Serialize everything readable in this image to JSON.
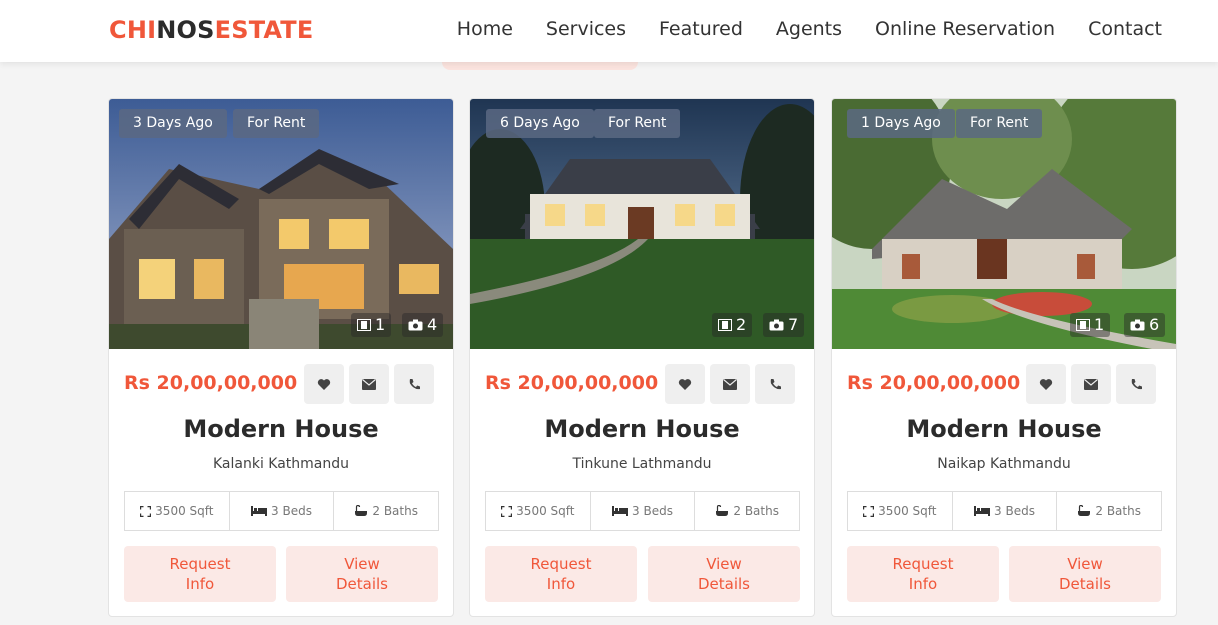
{
  "brand": {
    "part1": "CHI",
    "part2": "NOS",
    "part3": "ESTATE"
  },
  "nav": [
    "Home",
    "Services",
    "Featured",
    "Agents",
    "Online Reservation",
    "Contact"
  ],
  "colors": {
    "accent": "#f0573a",
    "accent_light": "#fbe9e6",
    "tag_bg": "#5a6982"
  },
  "listings": [
    {
      "posted": "3 Days Ago",
      "status": "For Rent",
      "videos": "1",
      "photos": "4",
      "price": "Rs 20,00,00,000",
      "title": "Modern House",
      "location": "Kalanki Kathmandu",
      "area": "3500 Sqft",
      "beds": "3 Beds",
      "baths": "2 Baths",
      "btn_request": "Request\nInfo",
      "btn_view": "View\nDetails"
    },
    {
      "posted": "6 Days Ago",
      "status": "For Rent",
      "videos": "2",
      "photos": "7",
      "price": "Rs 20,00,00,000",
      "title": "Modern House",
      "location": "Tinkune Lathmandu",
      "area": "3500 Sqft",
      "beds": "3 Beds",
      "baths": "2 Baths",
      "btn_request": "Request\nInfo",
      "btn_view": "View\nDetails"
    },
    {
      "posted": "1 Days Ago",
      "status": "For Rent",
      "videos": "1",
      "photos": "6",
      "price": "Rs 20,00,00,000",
      "title": "Modern House",
      "location": "Naikap Kathmandu",
      "area": "3500 Sqft",
      "beds": "3 Beds",
      "baths": "2 Baths",
      "btn_request": "Request\nInfo",
      "btn_view": "View\nDetails"
    }
  ],
  "icons": {
    "favorite": "heart-icon",
    "email": "envelope-icon",
    "call": "phone-icon",
    "videos": "film-icon",
    "photos": "camera-icon",
    "area": "expand-icon",
    "beds": "bed-icon",
    "baths": "bath-icon"
  }
}
